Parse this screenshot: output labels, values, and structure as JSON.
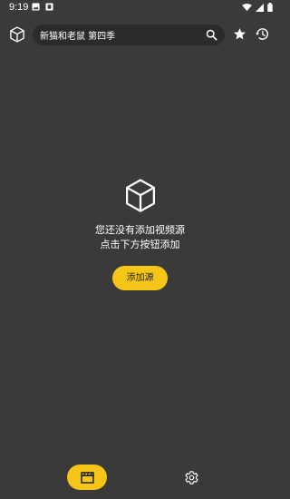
{
  "status_bar": {
    "time": "9:19"
  },
  "search": {
    "query": "新猫和老鼠 第四季"
  },
  "empty_state": {
    "line1": "您还没有添加视频源",
    "line2": "点击下方按钮添加"
  },
  "add_source_button": {
    "label": "添加源"
  },
  "colors": {
    "background": "#3a3a3a",
    "accent": "#f5c518",
    "search_bg": "#2b2b2b"
  },
  "icons": {
    "logo": "cube-icon",
    "search": "search-icon",
    "favorite": "star-icon",
    "history": "history-icon",
    "empty": "cube-outline-icon",
    "nav_home": "clapperboard-icon",
    "nav_settings": "gear-icon"
  }
}
